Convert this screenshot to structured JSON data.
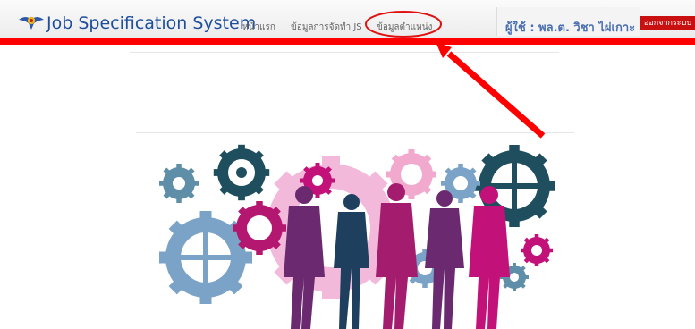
{
  "header": {
    "brand": "Job Specification System",
    "nav": [
      {
        "label": "หน้าแรก"
      },
      {
        "label": "ข้อมูลการจัดทำ JS"
      },
      {
        "label": "ข้อมูลตำแหน่ง"
      }
    ],
    "user": "ผู้ใช้ : พล.ต. วิชา ไผ่เกาะ",
    "logout": "ออกจากระบบ"
  },
  "colors": {
    "brand": "#1f4f9c",
    "annotation": "#ff0000",
    "logout_bg": "#c91010"
  }
}
